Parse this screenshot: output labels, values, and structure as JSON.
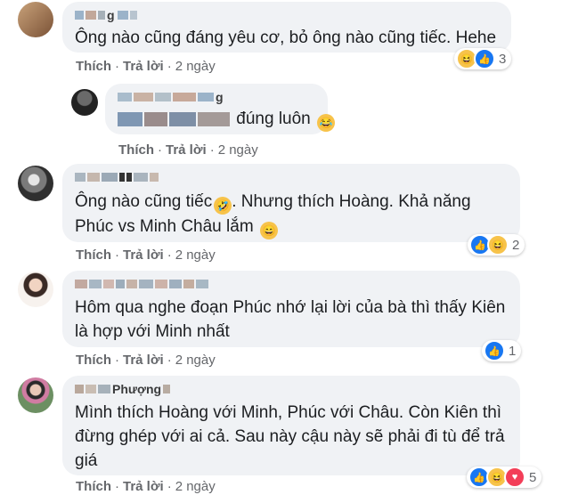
{
  "actions": {
    "like": "Thích",
    "reply": "Trả lời",
    "sep": "·"
  },
  "comments": [
    {
      "name": "g",
      "text": "Ông nào cũng đáng yêu cơ, bỏ ông nào cũng tiếc. Hehe",
      "time": "2 ngày",
      "reaction_count": "3"
    },
    {
      "name": "g",
      "text": "đúng luôn",
      "time": "2 ngày",
      "reaction_count": ""
    },
    {
      "name": "",
      "text_lines": [
        "Ông nào cũng tiếc",
        ". Nhưng thích Hoàng. Khả năng",
        "Phúc vs Minh Châu lắm"
      ],
      "time": "2 ngày",
      "reaction_count": "2"
    },
    {
      "name": "",
      "text_lines": [
        "Hôm qua nghe đoạn Phúc nhớ lại lời của bà thì thấy Kiên",
        "là hợp với Minh nhất"
      ],
      "time": "2 ngày",
      "reaction_count": "1"
    },
    {
      "name": "Phượng",
      "text_lines": [
        "Mình thích Hoàng với Minh, Phúc với Châu. Còn Kiên thì",
        "đừng ghép với ai cả. Sau này cậu này sẽ phải đi tù để trả",
        "giá"
      ],
      "time": "2 ngày",
      "reaction_count": "5"
    }
  ],
  "icons": {
    "haha": "haha-icon",
    "like": "like-icon",
    "love": "love-icon",
    "rofl": "rofl-emoji-icon",
    "grin": "grin-emoji-icon",
    "laugh": "laugh-emoji-icon"
  },
  "colors": {
    "bubble": "#f0f2f5",
    "meta": "#65676b",
    "like": "#1877f2",
    "haha": "#f7c34a",
    "love": "#f33e58"
  }
}
